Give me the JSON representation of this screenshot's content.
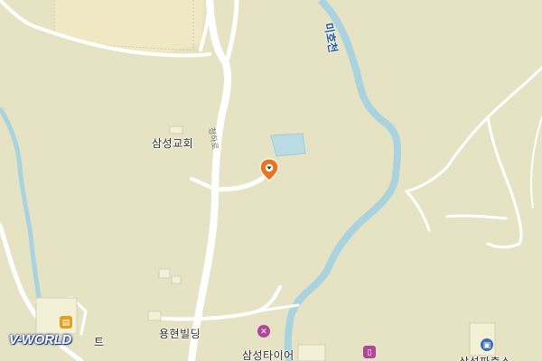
{
  "map": {
    "places": {
      "church": "삼성교회",
      "building": "용현빌딩",
      "tire": "삼성타이어",
      "partial_right": "삼성파출소",
      "partial_left": "트"
    },
    "river_name": "미호천",
    "road_label": "청하로",
    "logo": "V-WORLD",
    "colors": {
      "land": "#e6e3c4",
      "river": "#a9d3df",
      "road": "#ffffff",
      "marker": "#e8761e",
      "tire_icon": "#b0479a"
    }
  }
}
